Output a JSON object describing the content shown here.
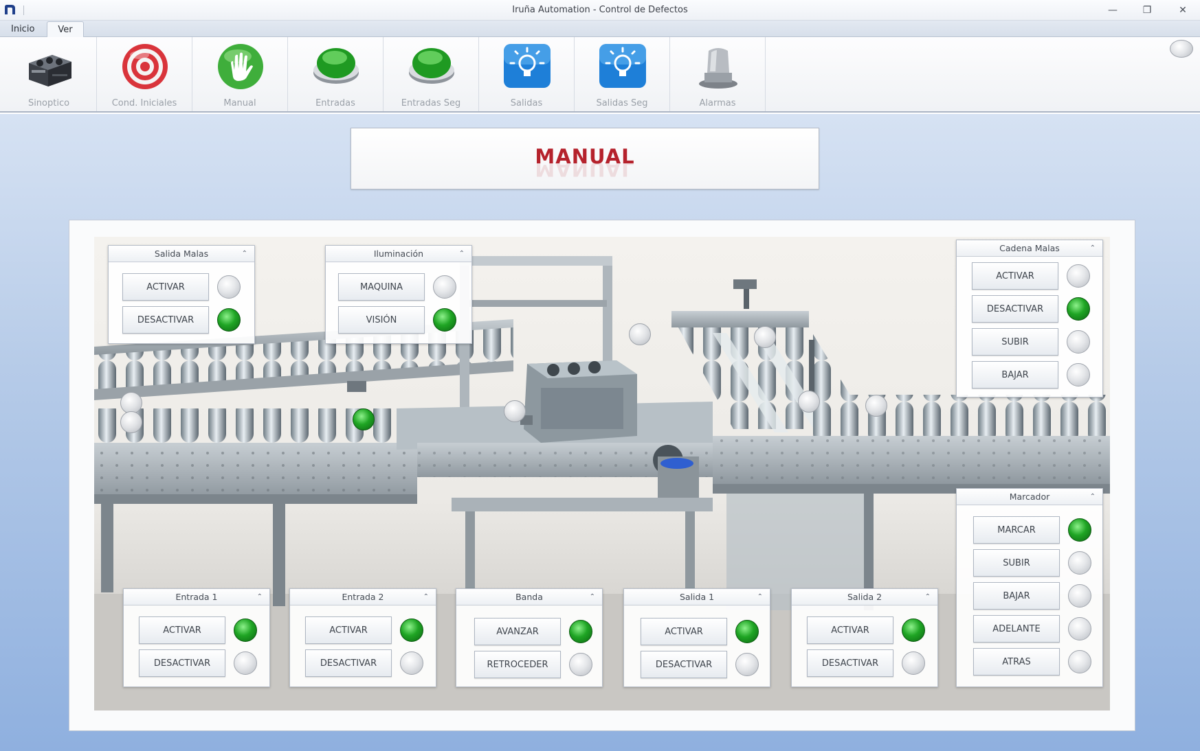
{
  "window": {
    "title": "Iruña Automation - Control de Defectos",
    "minimize_glyph": "—",
    "restore_glyph": "❐",
    "close_glyph": "✕"
  },
  "tabs": [
    {
      "label": "Inicio",
      "active": false
    },
    {
      "label": "Ver",
      "active": true
    }
  ],
  "ribbon": [
    {
      "label": "Sinoptico",
      "icon": "engine-block-icon"
    },
    {
      "label": "Cond. Iniciales",
      "icon": "target-icon"
    },
    {
      "label": "Manual",
      "icon": "hand-icon"
    },
    {
      "label": "Entradas",
      "icon": "green-button-icon"
    },
    {
      "label": "Entradas Seg",
      "icon": "green-button-icon"
    },
    {
      "label": "Salidas",
      "icon": "lightbulb-icon"
    },
    {
      "label": "Salidas Seg",
      "icon": "lightbulb-icon"
    },
    {
      "label": "Alarmas",
      "icon": "alarm-beacon-icon"
    }
  ],
  "mode": {
    "title": "MANUAL"
  },
  "groups": {
    "salida_malas": {
      "title": "Salida Malas",
      "buttons": [
        {
          "label": "ACTIVAR",
          "lamp": "off"
        },
        {
          "label": "DESACTIVAR",
          "lamp": "on"
        }
      ]
    },
    "iluminacion": {
      "title": "Iluminación",
      "buttons": [
        {
          "label": "MAQUINA",
          "lamp": "off"
        },
        {
          "label": "VISIÓN",
          "lamp": "on"
        }
      ]
    },
    "cadena_malas": {
      "title": "Cadena Malas",
      "buttons": [
        {
          "label": "ACTIVAR",
          "lamp": "off"
        },
        {
          "label": "DESACTIVAR",
          "lamp": "on"
        },
        {
          "label": "SUBIR",
          "lamp": "off"
        },
        {
          "label": "BAJAR",
          "lamp": "off"
        }
      ]
    },
    "marcador": {
      "title": "Marcador",
      "buttons": [
        {
          "label": "MARCAR",
          "lamp": "on"
        },
        {
          "label": "SUBIR",
          "lamp": "off"
        },
        {
          "label": "BAJAR",
          "lamp": "off"
        },
        {
          "label": "ADELANTE",
          "lamp": "off"
        },
        {
          "label": "ATRAS",
          "lamp": "off"
        }
      ]
    },
    "entrada_1": {
      "title": "Entrada 1",
      "buttons": [
        {
          "label": "ACTIVAR",
          "lamp": "on"
        },
        {
          "label": "DESACTIVAR",
          "lamp": "off"
        }
      ]
    },
    "entrada_2": {
      "title": "Entrada 2",
      "buttons": [
        {
          "label": "ACTIVAR",
          "lamp": "on"
        },
        {
          "label": "DESACTIVAR",
          "lamp": "off"
        }
      ]
    },
    "banda": {
      "title": "Banda",
      "buttons": [
        {
          "label": "AVANZAR",
          "lamp": "on"
        },
        {
          "label": "RETROCEDER",
          "lamp": "off"
        }
      ]
    },
    "salida_1": {
      "title": "Salida 1",
      "buttons": [
        {
          "label": "ACTIVAR",
          "lamp": "on"
        },
        {
          "label": "DESACTIVAR",
          "lamp": "off"
        }
      ]
    },
    "salida_2": {
      "title": "Salida 2",
      "buttons": [
        {
          "label": "ACTIVAR",
          "lamp": "on"
        },
        {
          "label": "DESACTIVAR",
          "lamp": "off"
        }
      ]
    }
  },
  "collapse_glyph": "⌃",
  "colors": {
    "mode_title": "#b5222c",
    "lamp_on": "#1fa524",
    "lamp_off": "#d8dadd"
  }
}
